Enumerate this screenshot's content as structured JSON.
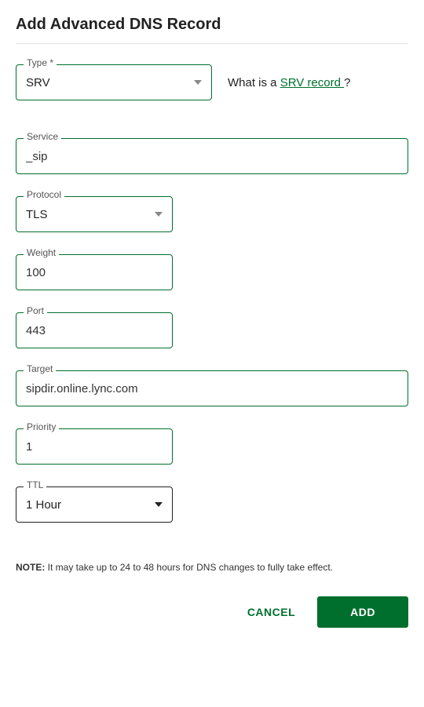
{
  "title": "Add Advanced DNS Record",
  "fields": {
    "type": {
      "label": "Type *",
      "value": "SRV"
    },
    "service": {
      "label": "Service",
      "value": "_sip"
    },
    "protocol": {
      "label": "Protocol",
      "value": "TLS"
    },
    "weight": {
      "label": "Weight",
      "value": "100"
    },
    "port": {
      "label": "Port",
      "value": "443"
    },
    "target": {
      "label": "Target",
      "value": "sipdir.online.lync.com"
    },
    "priority": {
      "label": "Priority",
      "value": "1"
    },
    "ttl": {
      "label": "TTL",
      "value": "1 Hour"
    }
  },
  "helper": {
    "prefix": "What is a ",
    "link_text": "SRV record ",
    "suffix": "?"
  },
  "note": {
    "label": "NOTE:",
    "text": " It may take up to 24 to 48 hours for DNS changes to fully take effect."
  },
  "buttons": {
    "cancel": "CANCEL",
    "add": "ADD"
  }
}
